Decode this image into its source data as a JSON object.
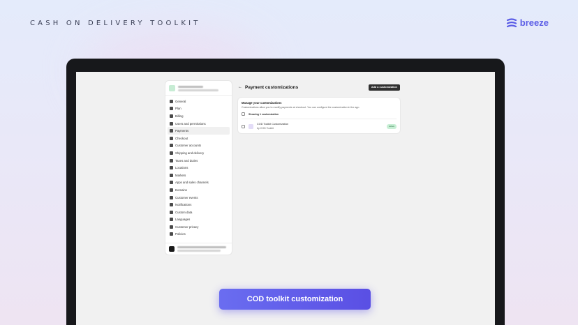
{
  "header": {
    "headline": "CASH ON DELIVERY TOOLKIT",
    "brand": "breeze"
  },
  "settings": {
    "nav": [
      {
        "label": "General",
        "icon": "store-icon"
      },
      {
        "label": "Plan",
        "icon": "plan-icon"
      },
      {
        "label": "Billing",
        "icon": "billing-icon"
      },
      {
        "label": "Users and permissions",
        "icon": "users-icon"
      },
      {
        "label": "Payments",
        "icon": "payments-icon",
        "active": true
      },
      {
        "label": "Checkout",
        "icon": "cart-icon"
      },
      {
        "label": "Customer accounts",
        "icon": "person-icon"
      },
      {
        "label": "Shipping and delivery",
        "icon": "truck-icon"
      },
      {
        "label": "Taxes and duties",
        "icon": "tax-icon"
      },
      {
        "label": "Locations",
        "icon": "location-icon"
      },
      {
        "label": "Markets",
        "icon": "globe-icon"
      },
      {
        "label": "Apps and sales channels",
        "icon": "apps-icon"
      },
      {
        "label": "Domains",
        "icon": "globe-icon"
      },
      {
        "label": "Customer events",
        "icon": "events-icon"
      },
      {
        "label": "Notifications",
        "icon": "bell-icon"
      },
      {
        "label": "Custom data",
        "icon": "data-icon"
      },
      {
        "label": "Languages",
        "icon": "language-icon"
      },
      {
        "label": "Customer privacy",
        "icon": "lock-icon"
      },
      {
        "label": "Policies",
        "icon": "policy-icon"
      }
    ]
  },
  "main": {
    "title": "Payment customizations",
    "add_button": "Add a customization",
    "card": {
      "title": "Manage your customizations",
      "description": "Customizations allow you to modify payments at checkout. You can configure the customization in the app.",
      "showing": "Showing 1 customization",
      "item": {
        "name": "COD Toolkit Customization",
        "by": "by COD Toolkit",
        "status": "Active"
      }
    }
  },
  "caption": {
    "label": "COD toolkit customization"
  }
}
